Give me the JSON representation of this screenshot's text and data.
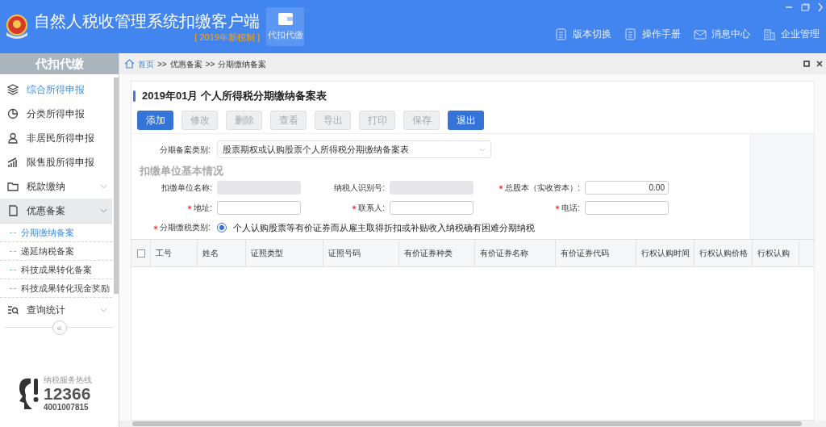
{
  "app": {
    "title": "自然人税收管理系统扣缴客户端",
    "subtitle": "[ 2019年新税制 ]",
    "module_button": "代扣代缴"
  },
  "top_links": [
    {
      "kind": "doc",
      "label": "版本切换"
    },
    {
      "kind": "doc",
      "label": "操作手册"
    },
    {
      "kind": "mail",
      "label": "消息中心"
    },
    {
      "kind": "building",
      "label": "企业管理"
    }
  ],
  "sidebar": {
    "title": "代扣代缴",
    "items": [
      {
        "kind": "layers",
        "label": "综合所得申报",
        "selected": true,
        "expanded": false,
        "has_children": false
      },
      {
        "kind": "pie",
        "label": "分类所得申报",
        "selected": false,
        "expanded": false,
        "has_children": false
      },
      {
        "kind": "person",
        "label": "非居民所得申报",
        "selected": false,
        "expanded": false,
        "has_children": false
      },
      {
        "kind": "bars",
        "label": "限售股所得申报",
        "selected": false,
        "expanded": false,
        "has_children": false
      },
      {
        "kind": "folder",
        "label": "税款缴纳",
        "selected": false,
        "expanded": false,
        "has_children": true
      },
      {
        "kind": "file",
        "label": "优惠备案",
        "selected": false,
        "expanded": true,
        "has_children": true,
        "children": [
          {
            "label": "分期缴纳备案",
            "selected": true
          },
          {
            "label": "递延纳税备案",
            "selected": false
          },
          {
            "label": "科技成果转化备案",
            "selected": false
          },
          {
            "label": "科技成果转化现金奖励",
            "selected": false
          }
        ]
      },
      {
        "kind": "search",
        "label": "查询统计",
        "selected": false,
        "expanded": false,
        "has_children": true
      }
    ],
    "collapse": "«",
    "hotline": {
      "label": "纳税服务热线",
      "number": "12366",
      "alt_number": "4001007815"
    }
  },
  "breadcrumb": [
    "首页",
    "优惠备案",
    "分期缴纳备案"
  ],
  "breadcrumb_separator": ">>",
  "form": {
    "title": "2019年01月  个人所得税分期缴纳备案表",
    "buttons": [
      {
        "label": "添加",
        "disabled": false
      },
      {
        "label": "修改",
        "disabled": true
      },
      {
        "label": "删除",
        "disabled": true
      },
      {
        "label": "查看",
        "disabled": true
      },
      {
        "label": "导出",
        "disabled": true
      },
      {
        "label": "打印",
        "disabled": true
      },
      {
        "label": "保存",
        "disabled": true
      },
      {
        "label": "退出",
        "disabled": false
      }
    ],
    "category_label": "分期备案类别:",
    "category_value": "股票期权或认购股票个人所得税分期缴纳备案表",
    "section": "扣缴单位基本情况",
    "fields": [
      {
        "label": "扣缴单位名称:",
        "required": false,
        "disabled": true
      },
      {
        "label": "纳税人识别号:",
        "required": false,
        "disabled": true
      },
      {
        "label": "总股本（实收资本）:",
        "required": true,
        "value": "0.00",
        "disabled": false
      },
      {
        "label": "地址:",
        "required": true,
        "disabled": false
      },
      {
        "label": "联系人:",
        "required": true,
        "disabled": false
      },
      {
        "label": "电话:",
        "required": true,
        "disabled": false
      }
    ],
    "tax_type_label": "分期缴税类别:",
    "tax_type_required": true,
    "tax_type_options": [
      {
        "label": "个人认购股票等有价证券而从雇主取得折扣或补贴收入纳税确有困难分期纳税",
        "selected": true
      }
    ]
  },
  "table": {
    "select_all_checked": false,
    "columns": [
      "工号",
      "姓名",
      "证照类型",
      "证照号码",
      "有价证券种类",
      "有价证券名称",
      "有价证券代码",
      "行权认购时间",
      "行权认购价格",
      "行权认购"
    ]
  }
}
